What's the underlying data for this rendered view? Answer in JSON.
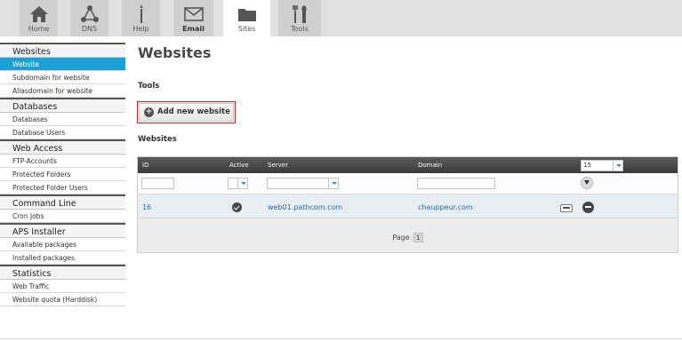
{
  "nav": {
    "tabs": [
      {
        "label": "Home",
        "icon": "home-icon"
      },
      {
        "label": "DNS",
        "icon": "dns-icon"
      },
      {
        "label": "Help",
        "icon": "help-icon"
      },
      {
        "label": "Email",
        "icon": "email-icon"
      },
      {
        "label": "Sites",
        "icon": "sites-icon"
      },
      {
        "label": "Tools",
        "icon": "tools-icon"
      }
    ],
    "active_tab": "Sites"
  },
  "sidebar": {
    "sections": [
      {
        "title": "Websites",
        "items": [
          "Website",
          "Subdomain for website",
          "Aliasdomain for website"
        ]
      },
      {
        "title": "Databases",
        "items": [
          "Databases",
          "Database Users"
        ]
      },
      {
        "title": "Web Access",
        "items": [
          "FTP-Accounts",
          "Protected Folders",
          "Protected Folder Users"
        ]
      },
      {
        "title": "Command Line",
        "items": [
          "Cron Jobs"
        ]
      },
      {
        "title": "APS Installer",
        "items": [
          "Available packages",
          "Installed packages"
        ]
      },
      {
        "title": "Statistics",
        "items": [
          "Web Traffic",
          "Website quota (Harddisk)"
        ]
      }
    ],
    "selected_item": "Website"
  },
  "main": {
    "title": "Websites",
    "tools_heading": "Tools",
    "add_button_label": "Add new website",
    "list_heading": "Websites"
  },
  "table": {
    "columns": [
      "ID",
      "Active",
      "Server",
      "Domain"
    ],
    "page_size": "15",
    "rows": [
      {
        "id": "16",
        "active": true,
        "server": "web01.pathcom.com",
        "domain": "chauppeur.com"
      }
    ],
    "pager": {
      "label": "Page",
      "current": "1"
    }
  },
  "colors": {
    "accent": "#1ba1d5",
    "add_button_border": "#cc2222",
    "link": "#2a6aaf"
  }
}
